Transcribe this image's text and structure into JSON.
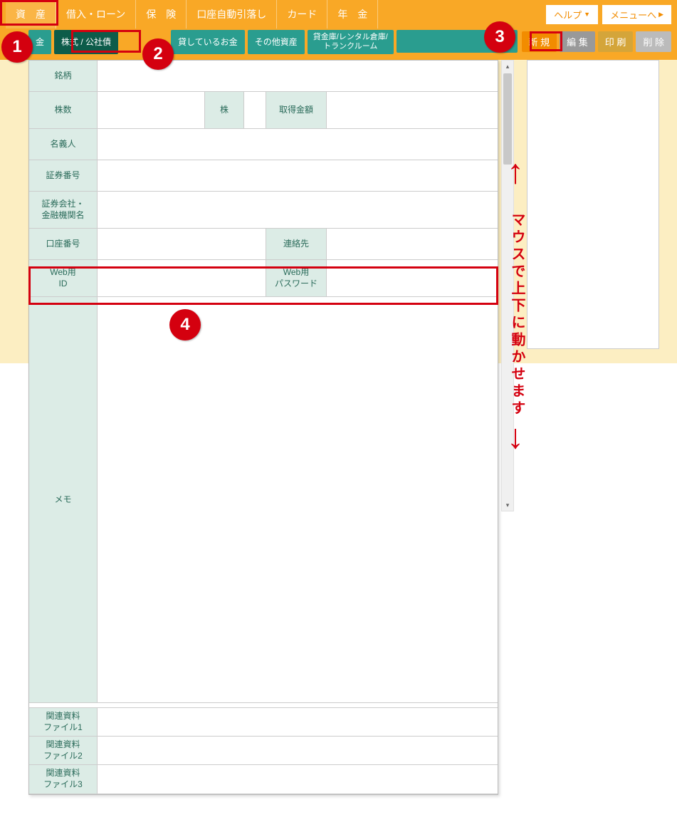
{
  "topnav": {
    "items": [
      {
        "label": "資　産"
      },
      {
        "label": "借入・ローン"
      },
      {
        "label": "保　険"
      },
      {
        "label": "口座自動引落し"
      },
      {
        "label": "カード"
      },
      {
        "label": "年　金"
      }
    ]
  },
  "topright": {
    "help": "ヘルプ",
    "menu": "メニューへ"
  },
  "subtabs": {
    "items": [
      {
        "label": "金"
      },
      {
        "label": "株式 / 公社債"
      },
      {
        "label": "貸しているお金"
      },
      {
        "label": "その他資産"
      },
      {
        "label_l1": "貸金庫/レンタル倉庫/",
        "label_l2": "トランクルーム"
      }
    ]
  },
  "actions": {
    "new": "新 規",
    "edit": "編 集",
    "print": "印 刷",
    "delete": "削 除"
  },
  "form": {
    "brand": "銘柄",
    "shares": "株数",
    "shares_unit": "株",
    "acq_amount": "取得金額",
    "holder": "名義人",
    "cert_no": "証券番号",
    "broker": "証券会社・\n金融機関名",
    "account_no": "口座番号",
    "contact": "連絡先",
    "web_id": "Web用\nID",
    "web_pw": "Web用\nパスワード",
    "memo": "メモ",
    "file1": "関連資料\nファイル1",
    "file2": "関連資料\nファイル2",
    "file3": "関連資料\nファイル3"
  },
  "callouts": {
    "c1": "1",
    "c2": "2",
    "c3": "3",
    "c4": "4"
  },
  "scroll_hint": "マウスで上下に動かせます",
  "colors": {
    "orange": "#f9a826",
    "teal": "#2a9d8f",
    "teal_dark": "#0d5c4a",
    "red": "#d4000f",
    "label_bg": "#dcece6",
    "label_fg": "#2a6b5a"
  }
}
